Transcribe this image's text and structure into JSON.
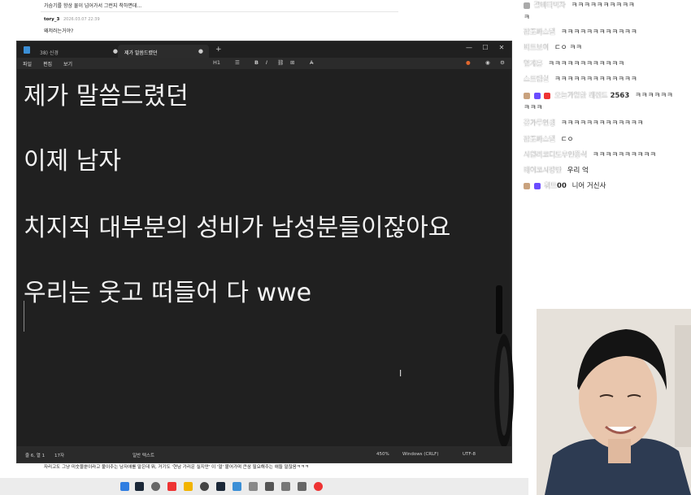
{
  "background_page": {
    "snippet": "가슴기를 항상 물이 넘어가서 그런지 착하면데...",
    "comment_user": "tory_3",
    "comment_date": "2026.03.07 22:39",
    "comment_text": "왜저러는거야?",
    "bottom_text": "자리고도 그냥 미숫물뿐이라고 불이주는 남자애를 말은데 뭐, 거기도 '현남 가리운 실지만' 이 '얼' 붙어가며 큰삼 필요해주는 애들 말잖음ㅋㅋㅋ"
  },
  "notepad": {
    "tabs": [
      {
        "label": "38) 신경"
      },
      {
        "label": "제가 말씀드렸던"
      }
    ],
    "menu": [
      "파일",
      "편집",
      "보기"
    ],
    "toolbar": {
      "heading": "H1",
      "list": "☰",
      "bold": "B",
      "italic": "I",
      "link": "⛓",
      "table": "⊞",
      "clear": "A̶"
    },
    "lines": [
      "제가 말씀드렸던",
      "이제 남자",
      "치지직 대부분의 성비가 남성분들이잖아요",
      "우리는 웃고 떠들어 다 wwe"
    ],
    "status": {
      "position": "줄 6, 열 1",
      "chars": "17자",
      "format": "일반 텍스트",
      "zoom": "450%",
      "line_ending": "Windows (CRLF)",
      "encoding": "UTF-8"
    }
  },
  "chat": [
    {
      "name": "갈비뼈먹자",
      "msg": "ㅋㅋㅋㅋㅋㅋㅋㅋㅋㅋ"
    },
    {
      "name": "",
      "msg": "ㅋ"
    },
    {
      "name": "잠조파스텔",
      "msg": "ㅋㅋㅋㅋㅋㅋㅋㅋㅋㅋㅋㅋ"
    },
    {
      "name": "버트보이",
      "msg": "ㄷㅇ ㅋㅋ"
    },
    {
      "name": "임개훈",
      "msg": "ㅋㅋㅋㅋㅋㅋㅋㅋㅋㅋㅋㅋ"
    },
    {
      "name": "스트랩실",
      "msg": "ㅋㅋㅋㅋㅋㅋㅋㅋㅋㅋㅋㅋㅋ"
    },
    {
      "name": "오늘가입한 레전드 2563",
      "msg": "ㅋㅋㅋㅋㅋㅋ"
    },
    {
      "name": "",
      "msg": "ㅋㅋㅋ"
    },
    {
      "name": "꽃가루인생",
      "msg": "ㅋㅋㅋㅋㅋㅋㅋㅋㅋㅋㅋㅋㅋ"
    },
    {
      "name": "잠조파스텔",
      "msg": "ㄷㅇ"
    },
    {
      "name": "서원리코디도우인증식",
      "msg": "ㅋㅋㅋㅋㅋㅋㅋㅋㅋㅋ"
    },
    {
      "name": "베이코시팡탄",
      "msg": "우리 억"
    },
    {
      "name": "휘트00",
      "msg": "니어 거신사"
    }
  ],
  "colors": {
    "notepad_bg": "#202020",
    "text": "#f2f2f2",
    "accent": "#3b8fd6"
  }
}
